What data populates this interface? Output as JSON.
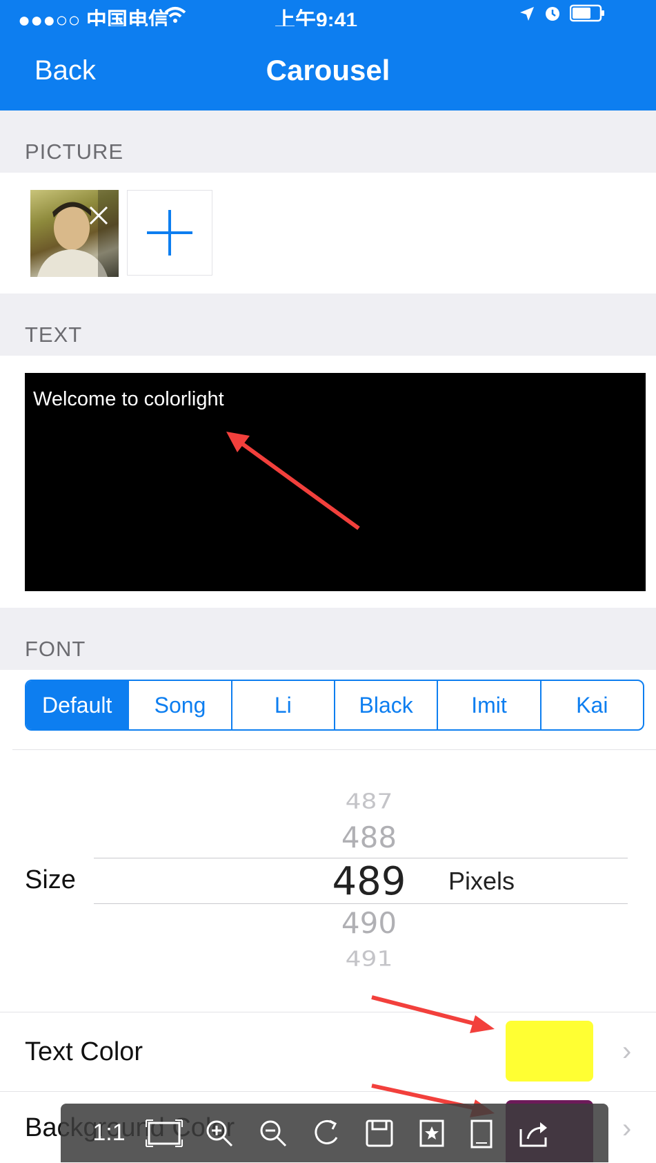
{
  "status_bar": {
    "carrier": "●●●○○ 中国电信",
    "time": "上午9:41"
  },
  "nav": {
    "back_label": "Back",
    "title": "Carousel"
  },
  "sections": {
    "picture_header": "PICTURE",
    "text_header": "TEXT",
    "font_header": "FONT"
  },
  "preview": {
    "text": "Welcome to colorlight",
    "background": "#000000",
    "text_color": "#ffffff"
  },
  "font_options": [
    "Default",
    "Song",
    "Li",
    "Black",
    "Imit",
    "Kai"
  ],
  "font_selected": "Default",
  "size": {
    "label": "Size",
    "values": [
      "487",
      "488",
      "489",
      "490",
      "491"
    ],
    "selected": "489",
    "unit": "Pixels"
  },
  "text_color": {
    "label": "Text Color",
    "swatch": "#ffff33"
  },
  "background_color": {
    "label": "Background Color",
    "swatch": "#6d1a5a"
  },
  "toolbar": {
    "zoom_label": "1:1"
  },
  "colors": {
    "accent": "#0d7ef0",
    "annotation_arrow": "#f2403c"
  }
}
